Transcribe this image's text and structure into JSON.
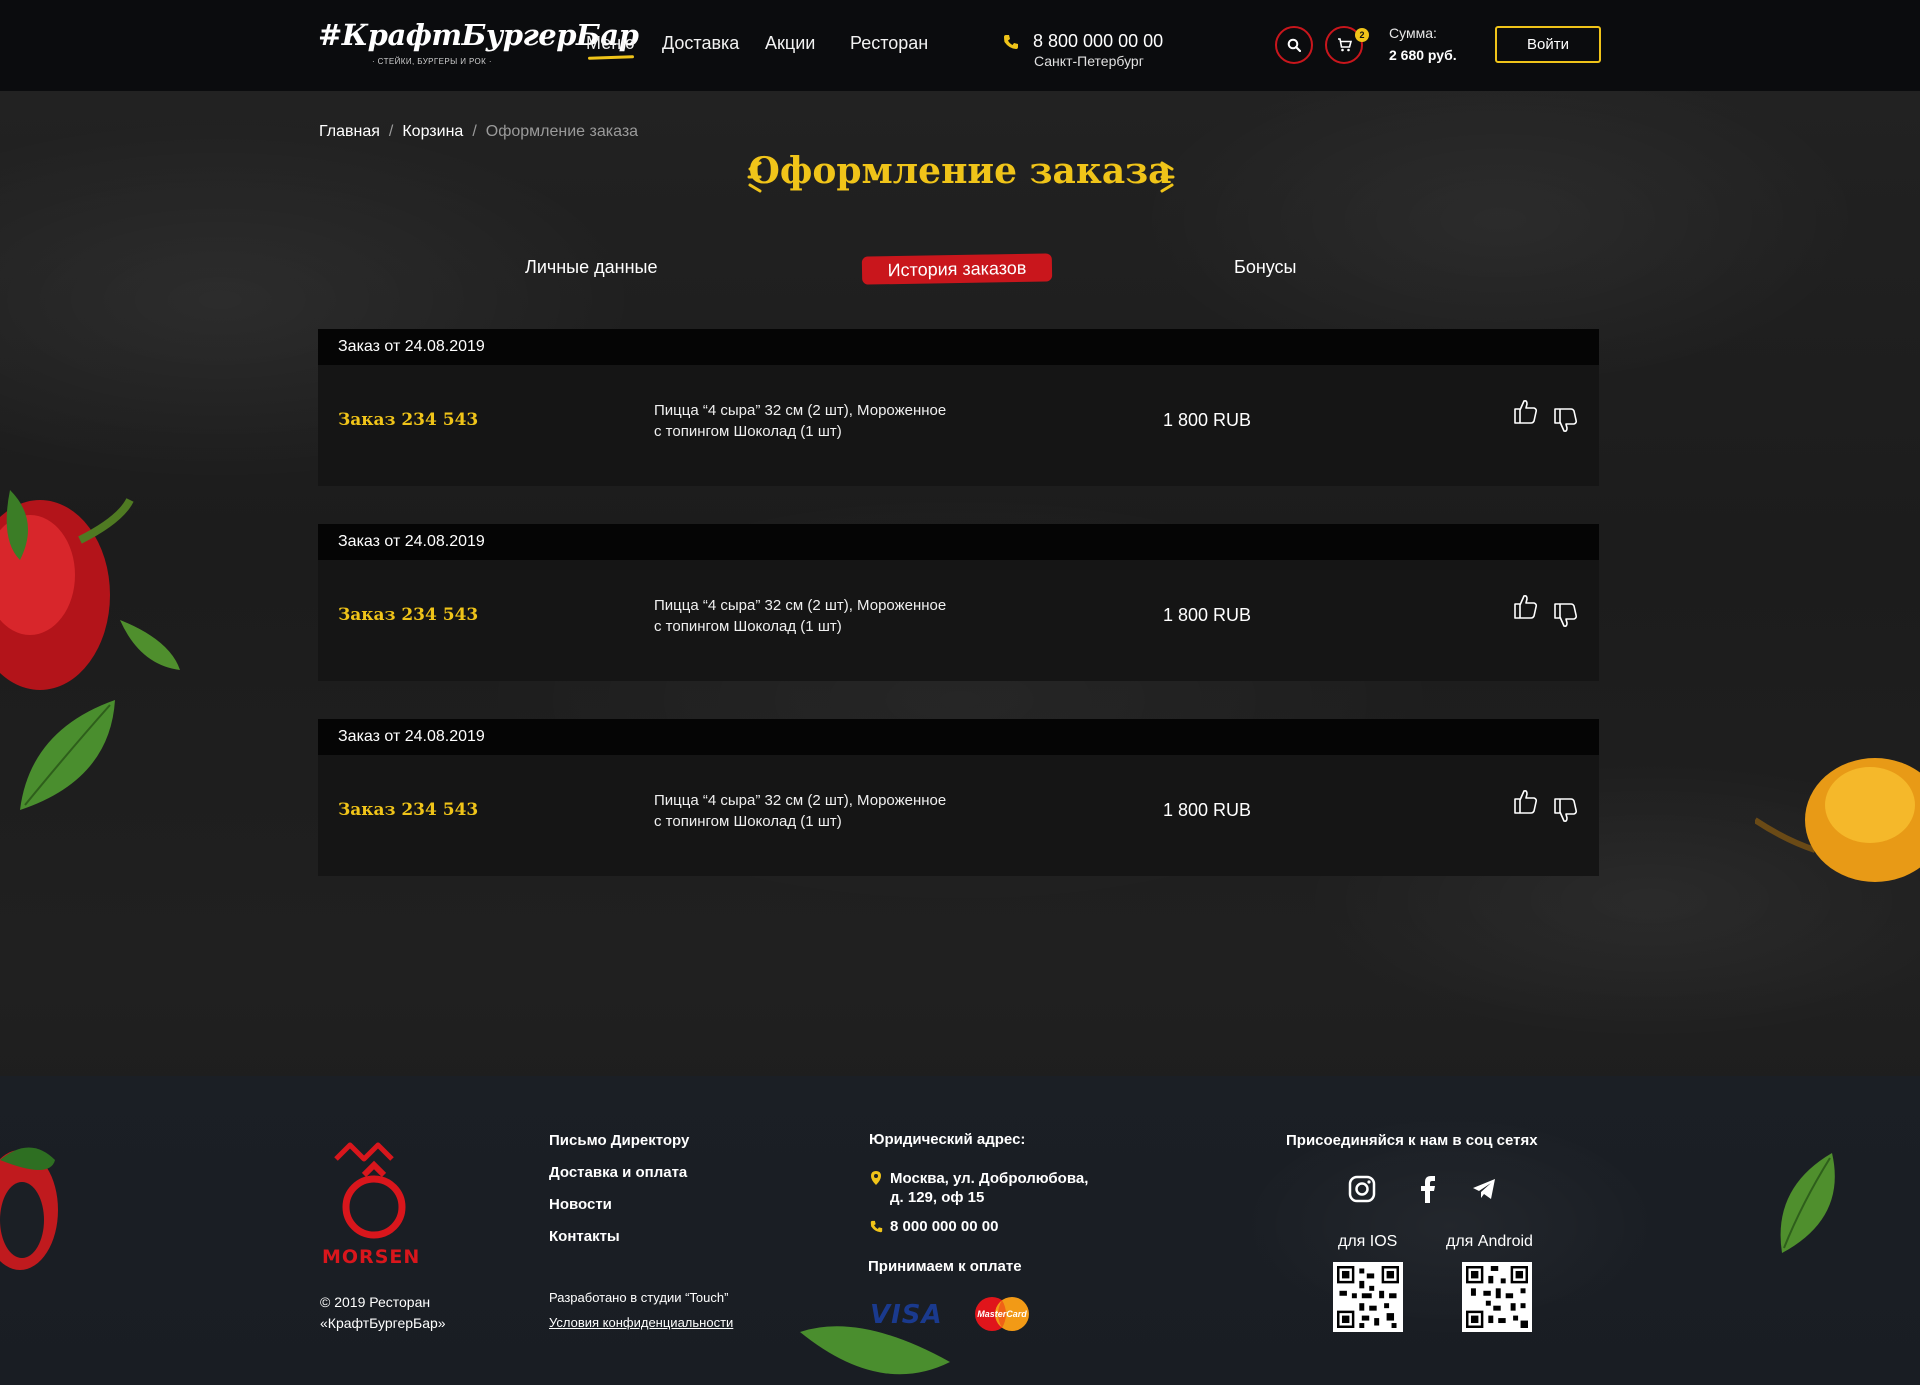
{
  "header": {
    "logo_text": "#КрафтБургерБар",
    "logo_tagline": "· СТЕЙКИ, БУРГЕРЫ И РОК ·",
    "nav": [
      "Меню",
      "Доставка",
      "Акции",
      "Ресторан"
    ],
    "phone": "8 800 000 00 00",
    "city": "Санкт-Петербург",
    "cart_count": "2",
    "sum_label": "Сумма:",
    "sum_value": "2 680 руб.",
    "login_label": "Войти"
  },
  "breadcrumb": {
    "home": "Главная",
    "cart": "Корзина",
    "current": "Оформление заказа",
    "separator": "/"
  },
  "page_title": "Оформление заказа",
  "tabs": [
    "Личные данные",
    "История заказов",
    "Бонусы"
  ],
  "active_tab": "История заказов",
  "orders": [
    {
      "date": "Заказ от 24.08.2019",
      "number": "Заказ 234 543",
      "items_line1": "Пицца “4 сыра” 32 см (2 шт), Мороженное",
      "items_line2": "с топингом Шоколад (1 шт)",
      "price": "1 800 RUB"
    },
    {
      "date": "Заказ от 24.08.2019",
      "number": "Заказ 234 543",
      "items_line1": "Пицца “4 сыра” 32 см (2 шт), Мороженное",
      "items_line2": "с топингом Шоколад (1 шт)",
      "price": "1 800 RUB"
    },
    {
      "date": "Заказ от 24.08.2019",
      "number": "Заказ 234 543",
      "items_line1": "Пицца “4 сыра” 32 см (2 шт), Мороженное",
      "items_line2": "с топингом Шоколад (1 шт)",
      "price": "1 800 RUB"
    }
  ],
  "footer": {
    "brand": "MORSEN",
    "copyright_line1": "© 2019 Ресторан",
    "copyright_line2": "«КрафтБургерБар»",
    "links": [
      "Письмо Директору",
      "Доставка и оплата",
      "Новости",
      "Контакты"
    ],
    "dev_text": "Разработано в студии “Touch”",
    "privacy": "Условия конфиденциальности",
    "legal_title": "Юридический адрес:",
    "address_line1": "Москва, ул. Добролюбова,",
    "address_line2": "д. 129, оф 15",
    "phone": "8 000 000 00 00",
    "payment_title": "Принимаем к оплате",
    "visa": "VISA",
    "mastercard": "MasterCard",
    "social_title": "Присоединяйся к нам в соц сетях",
    "ios_label": "для IOS",
    "android_label": "для Android"
  },
  "colors": {
    "accent_yellow": "#f0c419",
    "accent_red": "#c9161c",
    "header_bg": "#0b0c0e",
    "card_bg": "#151515"
  },
  "icons": [
    "search-icon",
    "cart-icon",
    "phone-icon",
    "thumbs-up-icon",
    "thumbs-down-icon",
    "location-icon",
    "instagram-icon",
    "facebook-icon",
    "telegram-icon"
  ]
}
